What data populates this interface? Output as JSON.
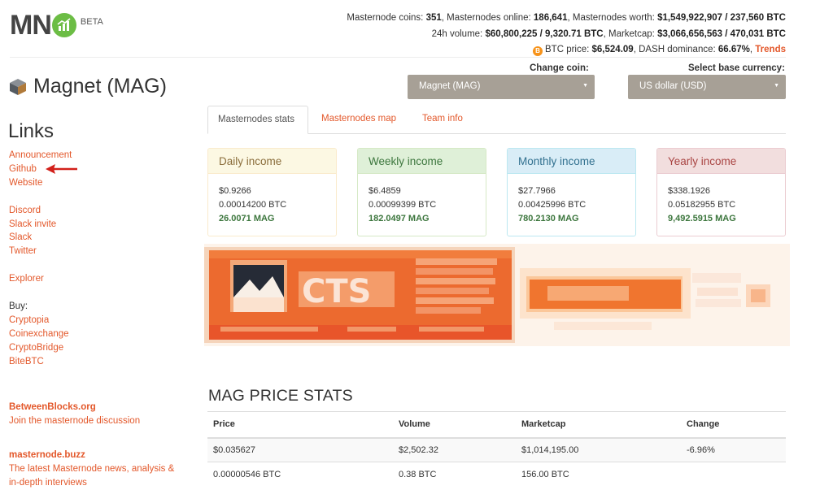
{
  "logo": {
    "text": "MN",
    "beta": "BETA"
  },
  "topstats": {
    "line1": [
      {
        "t": "Masternode coins: ",
        "b": false
      },
      {
        "t": "351",
        "b": true
      },
      {
        "t": ", Masternodes online: ",
        "b": false
      },
      {
        "t": "186,641",
        "b": true
      },
      {
        "t": ", Masternodes worth: ",
        "b": false
      },
      {
        "t": "$1,549,922,907 / 237,560 BTC",
        "b": true
      }
    ],
    "line2": [
      {
        "t": "24h volume: ",
        "b": false
      },
      {
        "t": "$60,800,225 / 9,320.71 BTC",
        "b": true
      },
      {
        "t": ", Marketcap: ",
        "b": false
      },
      {
        "t": "$3,066,656,563 / 470,031 BTC",
        "b": true
      }
    ],
    "btc_icon": "B",
    "line3_prefix": "BTC price: ",
    "btc_price": "$6,524.09",
    "dominance_label": ", DASH dominance: ",
    "dominance_value": "66.67%",
    "sep": ", ",
    "trends_label": "Trends"
  },
  "coin": {
    "name": "Magnet (MAG)"
  },
  "selectors": {
    "coin_label": "Change coin:",
    "coin_value": "Magnet (MAG)",
    "currency_label": "Select base currency:",
    "currency_value": "US dollar (USD)"
  },
  "tabs": [
    {
      "label": "Masternodes stats",
      "active": true
    },
    {
      "label": "Masternodes map",
      "active": false
    },
    {
      "label": "Team info",
      "active": false
    }
  ],
  "sidebar": {
    "heading": "Links",
    "links1": [
      "Announcement",
      "Github",
      "Website"
    ],
    "links2": [
      "Discord",
      "Slack invite",
      "Slack",
      "Twitter"
    ],
    "links3": [
      "Explorer"
    ],
    "buy_label": "Buy:",
    "buy_links": [
      "Cryptopia",
      "Coinexchange",
      "CryptoBridge",
      "BiteBTC"
    ],
    "promo1_title": "BetweenBlocks.org",
    "promo1_text": "Join the masternode discussion",
    "promo2_title": "masternode.buzz",
    "promo2_text_1": "The latest Masternode news, analysis &",
    "promo2_text_2": "in-depth interviews"
  },
  "income": {
    "daily": {
      "title": "Daily income",
      "usd": "$0.9266",
      "btc": "0.00014200 BTC",
      "mag": "26.0071 MAG"
    },
    "weekly": {
      "title": "Weekly income",
      "usd": "$6.4859",
      "btc": "0.00099399 BTC",
      "mag": "182.0497 MAG"
    },
    "monthly": {
      "title": "Monthly income",
      "usd": "$27.7966",
      "btc": "0.00425996 BTC",
      "mag": "780.2130 MAG"
    },
    "yearly": {
      "title": "Yearly income",
      "usd": "$338.1926",
      "btc": "0.05182955 BTC",
      "mag": "9,492.5915 MAG"
    }
  },
  "price_stats": {
    "title": "MAG PRICE STATS",
    "headers": {
      "price": "Price",
      "volume": "Volume",
      "marketcap": "Marketcap",
      "change": "Change"
    },
    "row1": {
      "price": "$0.035627",
      "volume": "$2,502.32",
      "marketcap": "$1,014,195.00",
      "change": "-6.96%"
    },
    "row2": {
      "price": "0.00000546 BTC",
      "volume": "0.38 BTC",
      "marketcap": "156.00 BTC",
      "change": ""
    }
  },
  "colors": {
    "accent": "#e3582b",
    "brand_green": "#6cbd45",
    "select_bg": "#a7a096",
    "positive": "#3c763d",
    "negative": "#d9534f"
  }
}
